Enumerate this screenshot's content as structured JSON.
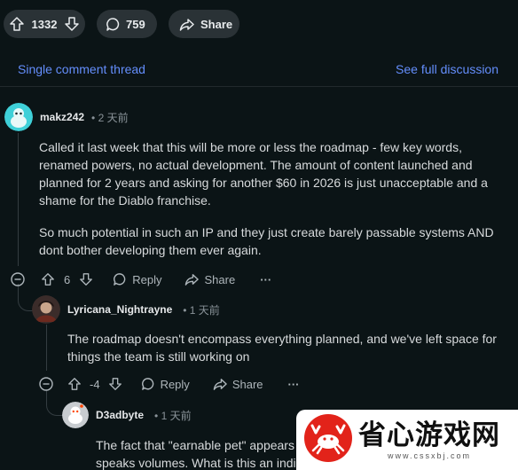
{
  "top_bar": {
    "vote_count": "1332",
    "comment_count": "759",
    "share_label": "Share"
  },
  "thread_links": {
    "single_thread": "Single comment thread",
    "full_discussion": "See full discussion"
  },
  "comments": [
    {
      "username": "makz242",
      "time": "• 2 天前",
      "paragraphs": [
        "Called it last week that this will be more or less the roadmap - few key words, renamed powers, no actual development. The amount of content launched and planned for 2 years and asking for another $60 in 2026 is just unacceptable and a shame for the Diablo franchise.",
        "So much potential in such an IP and they just create barely passable systems AND dont bother developing them ever again."
      ],
      "score": "6",
      "reply_label": "Reply",
      "share_label": "Share",
      "more_label": "···"
    },
    {
      "username": "Lyricana_Nightrayne",
      "time": "• 1 天前",
      "paragraphs": [
        "The roadmap doesn't encompass everything planned, and we've left space for things the team is still working on"
      ],
      "score": "-4",
      "reply_label": "Reply",
      "share_label": "Share",
      "more_label": "···"
    },
    {
      "username": "D3adbyte",
      "time": "• 1 天前",
      "paragraphs": [
        "The fact that \"earnable pet\" appears",
        "speaks volumes. What is this an indic"
      ]
    }
  ],
  "watermark": {
    "name": "省心游戏网",
    "url": "www.cssxbj.com"
  },
  "colors": {
    "background": "#0b1416",
    "link": "#648efc",
    "pill": "#2a3236",
    "watermark_red": "#e2231a"
  }
}
